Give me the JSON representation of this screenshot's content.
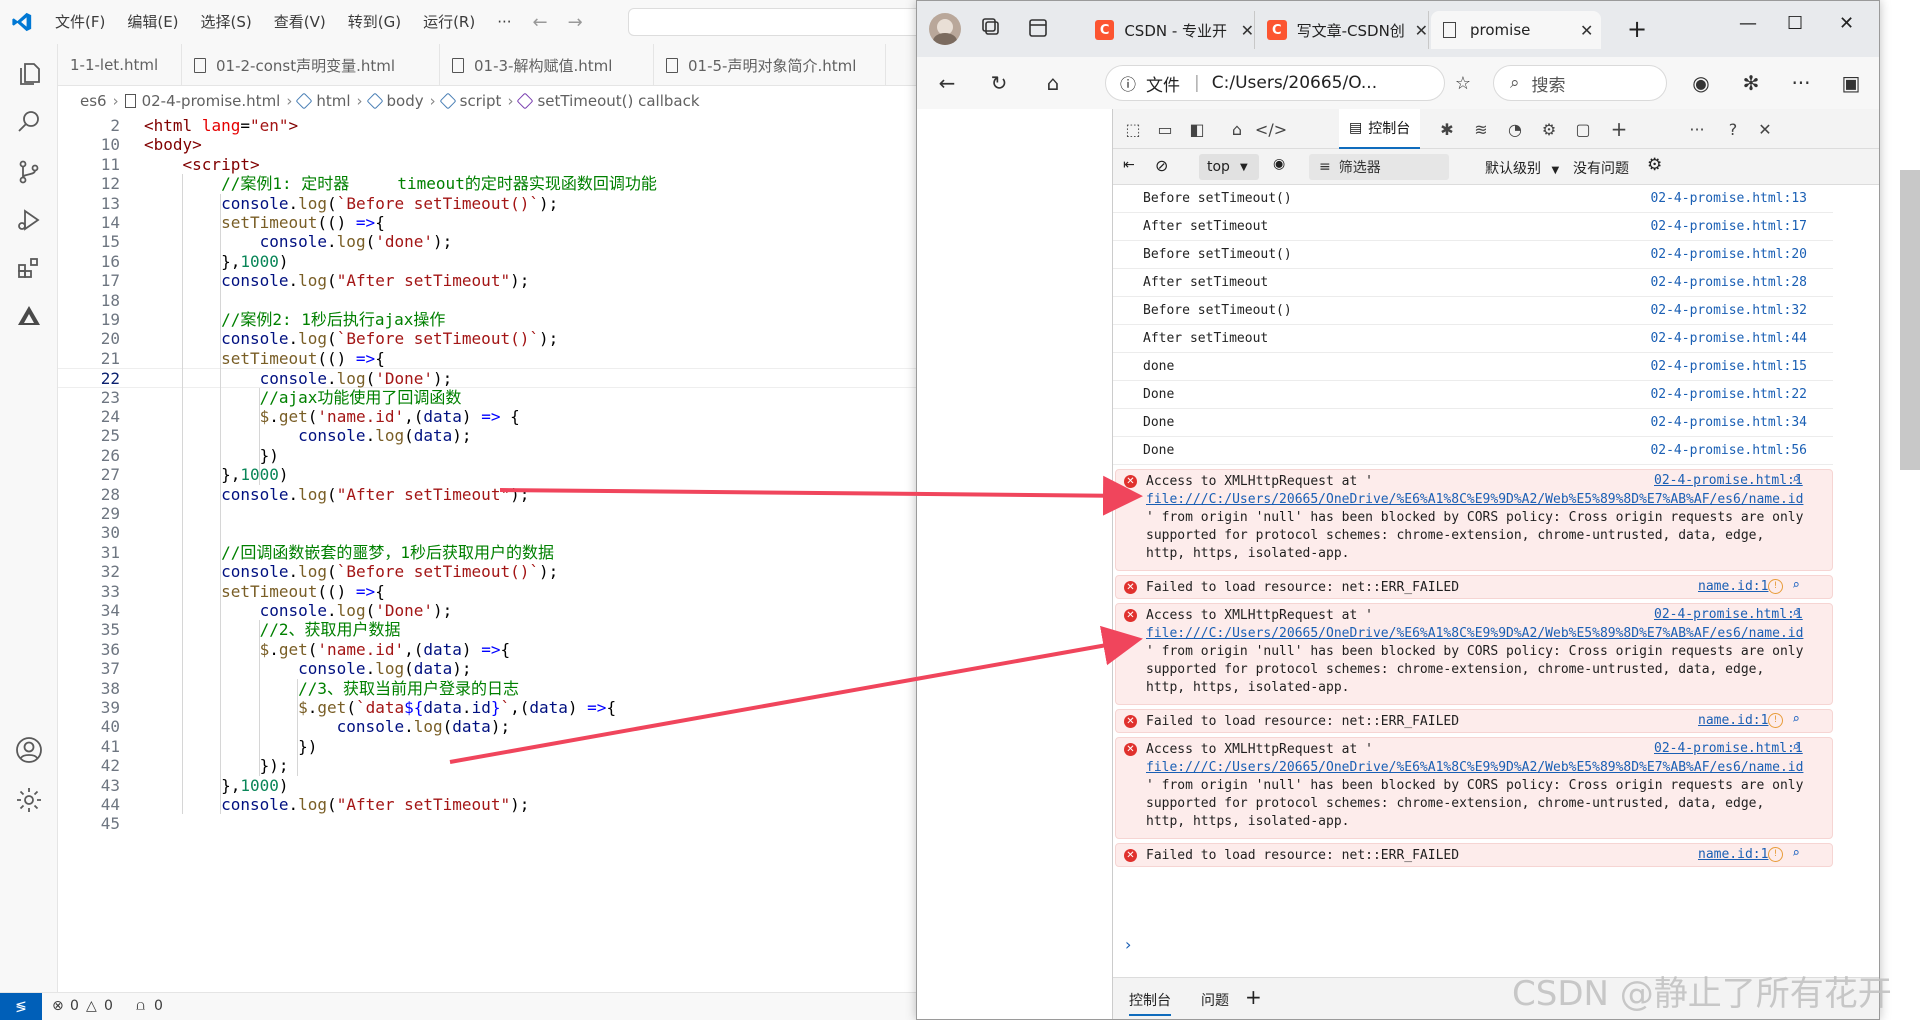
{
  "vscode": {
    "menu": [
      "文件(F)",
      "编辑(E)",
      "选择(S)",
      "查看(V)",
      "转到(G)",
      "运行(R)",
      "···"
    ],
    "tabs": [
      "1-1-let.html",
      "01-2-const声明变量.html",
      "01-3-解构赋值.html",
      "01-5-声明对象简介.html"
    ],
    "breadcrumb": [
      "es6",
      "02-4-promise.html",
      "html",
      "body",
      "script",
      "setTimeout() callback"
    ],
    "code_lines": [
      {
        "n": "2",
        "html": "<span class='tk-tag'>&lt;html</span> <span class='tk-attr'>lang</span>=<span class='tk-str'>\"en\"</span><span class='tk-tag'>&gt;</span>"
      },
      {
        "n": "10",
        "html": "<span class='tk-tag'>&lt;body&gt;</span>"
      },
      {
        "n": "11",
        "html": "    <span class='tk-tag'>&lt;script&gt;</span>"
      },
      {
        "n": "12",
        "html": "        <span class='tk-cmt'>//案例1: 定时器     timeout的定时器实现函数回调功能</span>"
      },
      {
        "n": "13",
        "html": "        <span class='tk-obj'>console</span>.<span class='tk-fn'>log</span>(<span class='tk-str'>`Before setTimeout()`</span>);"
      },
      {
        "n": "14",
        "html": "        <span class='tk-fn'>setTimeout</span>(() <span class='tk-kw'>=&gt;</span>{"
      },
      {
        "n": "15",
        "html": "            <span class='tk-obj'>console</span>.<span class='tk-fn'>log</span>(<span class='tk-str'>'done'</span>);"
      },
      {
        "n": "16",
        "html": "        },<span class='tk-num'>1000</span>)"
      },
      {
        "n": "17",
        "html": "        <span class='tk-obj'>console</span>.<span class='tk-fn'>log</span>(<span class='tk-str'>\"After setTimeout\"</span>);"
      },
      {
        "n": "18",
        "html": ""
      },
      {
        "n": "19",
        "html": "        <span class='tk-cmt'>//案例2: 1秒后执行ajax操作</span>"
      },
      {
        "n": "20",
        "html": "        <span class='tk-obj'>console</span>.<span class='tk-fn'>log</span>(<span class='tk-str'>`Before setTimeout()`</span>);"
      },
      {
        "n": "21",
        "html": "        <span class='tk-fn'>setTimeout</span>(() <span class='tk-kw'>=&gt;</span>{"
      },
      {
        "n": "22",
        "html": "            <span class='tk-obj'>console</span>.<span class='tk-fn'>log</span>(<span class='tk-str'>'Done'</span>);"
      },
      {
        "n": "23",
        "html": "            <span class='tk-cmt'>//ajax功能使用了回调函数</span>"
      },
      {
        "n": "24",
        "html": "            <span class='tk-fn'>$</span>.<span class='tk-fn'>get</span>(<span class='tk-str'>'name.id'</span>,(<span class='tk-obj'>data</span>) <span class='tk-kw'>=&gt;</span> {"
      },
      {
        "n": "25",
        "html": "                <span class='tk-obj'>console</span>.<span class='tk-fn'>log</span>(<span class='tk-obj'>data</span>);"
      },
      {
        "n": "26",
        "html": "            })"
      },
      {
        "n": "27",
        "html": "        },<span class='tk-num'>1000</span>)"
      },
      {
        "n": "28",
        "html": "        <span class='tk-obj'>console</span>.<span class='tk-fn'>log</span>(<span class='tk-str'>\"After setTimeout\"</span>);"
      },
      {
        "n": "29",
        "html": ""
      },
      {
        "n": "30",
        "html": ""
      },
      {
        "n": "31",
        "html": "        <span class='tk-cmt'>//回调函数嵌套的噩梦，1秒后获取用户的数据</span>"
      },
      {
        "n": "32",
        "html": "        <span class='tk-obj'>console</span>.<span class='tk-fn'>log</span>(<span class='tk-str'>`Before setTimeout()`</span>);"
      },
      {
        "n": "33",
        "html": "        <span class='tk-fn'>setTimeout</span>(() <span class='tk-kw'>=&gt;</span>{"
      },
      {
        "n": "34",
        "html": "            <span class='tk-obj'>console</span>.<span class='tk-fn'>log</span>(<span class='tk-str'>'Done'</span>);"
      },
      {
        "n": "35",
        "html": "            <span class='tk-cmt'>//2、获取用户数据</span>"
      },
      {
        "n": "36",
        "html": "            <span class='tk-fn'>$</span>.<span class='tk-fn'>get</span>(<span class='tk-str'>'name.id'</span>,(<span class='tk-obj'>data</span>) <span class='tk-kw'>=&gt;</span>{"
      },
      {
        "n": "37",
        "html": "                <span class='tk-obj'>console</span>.<span class='tk-fn'>log</span>(<span class='tk-obj'>data</span>);"
      },
      {
        "n": "38",
        "html": "                <span class='tk-cmt'>//3、获取当前用户登录的日志</span>"
      },
      {
        "n": "39",
        "html": "                <span class='tk-fn'>$</span>.<span class='tk-fn'>get</span>(<span class='tk-str'>`data</span><span class='tk-kw'>${</span><span class='tk-obj'>data</span>.<span class='tk-obj'>id</span><span class='tk-kw'>}</span><span class='tk-str'>`</span>,(<span class='tk-obj'>data</span>) <span class='tk-kw'>=&gt;</span>{"
      },
      {
        "n": "40",
        "html": "                    <span class='tk-obj'>console</span>.<span class='tk-fn'>log</span>(<span class='tk-obj'>data</span>);"
      },
      {
        "n": "41",
        "html": "                })"
      },
      {
        "n": "42",
        "html": "            });"
      },
      {
        "n": "43",
        "html": "        },<span class='tk-num'>1000</span>)"
      },
      {
        "n": "44",
        "html": "        <span class='tk-obj'>console</span>.<span class='tk-fn'>log</span>(<span class='tk-str'>\"After setTimeout\"</span>);"
      },
      {
        "n": "45",
        "html": ""
      }
    ],
    "active_line": "22",
    "status": {
      "errors": "0",
      "warnings": "0",
      "ports": "0"
    }
  },
  "browser": {
    "tabs": [
      {
        "title": "CSDN - 专业开",
        "icon": "csdn-logo"
      },
      {
        "title": "写文章-CSDN创",
        "icon": "csdn-logo"
      },
      {
        "title": "promise",
        "icon": "page-icon"
      }
    ],
    "address": {
      "scheme_label": "文件",
      "url": "C:/Users/20665/O..."
    },
    "search_label": "搜索",
    "devtools": {
      "active_tab": "控制台",
      "context": "top",
      "filter_label": "筛选器",
      "level_label": "默认级别",
      "issues_label": "没有问题",
      "logs": [
        {
          "msg": "Before setTimeout()",
          "src": "02-4-promise.html:13"
        },
        {
          "msg": "After setTimeout",
          "src": "02-4-promise.html:17"
        },
        {
          "msg": "Before setTimeout()",
          "src": "02-4-promise.html:20"
        },
        {
          "msg": "After setTimeout",
          "src": "02-4-promise.html:28"
        },
        {
          "msg": "Before setTimeout()",
          "src": "02-4-promise.html:32"
        },
        {
          "msg": "After setTimeout",
          "src": "02-4-promise.html:44"
        },
        {
          "msg": "done",
          "src": "02-4-promise.html:15"
        },
        {
          "msg": "Done",
          "src": "02-4-promise.html:22"
        },
        {
          "msg": "Done",
          "src": "02-4-promise.html:34"
        },
        {
          "msg": "Done",
          "src": "02-4-promise.html:56"
        }
      ],
      "errors": [
        {
          "line1": "Access to XMLHttpRequest at '",
          "src": "02-4-promise.html:1",
          "link": "file:///C:/Users/20665/OneDrive/%E6%A1%8C%E9%9D%A2/Web%E5%89%8D%E7%AB%AF/es6/name.id",
          "rest": "' from origin 'null' has been blocked by CORS policy: Cross origin requests are only\nsupported for protocol schemes: chrome-extension, chrome-untrusted, data, edge,\nhttp, https, isolated-app."
        },
        {
          "line1": "Failed to load resource: net::ERR_FAILED",
          "src": "name.id:1"
        },
        {
          "line1": "Access to XMLHttpRequest at '",
          "src": "02-4-promise.html:1",
          "link": "file:///C:/Users/20665/OneDrive/%E6%A1%8C%E9%9D%A2/Web%E5%89%8D%E7%AB%AF/es6/name.id",
          "rest": "' from origin 'null' has been blocked by CORS policy: Cross origin requests are only\nsupported for protocol schemes: chrome-extension, chrome-untrusted, data, edge,\nhttp, https, isolated-app."
        },
        {
          "line1": "Failed to load resource: net::ERR_FAILED",
          "src": "name.id:1"
        },
        {
          "line1": "Access to XMLHttpRequest at '",
          "src": "02-4-promise.html:1",
          "link": "file:///C:/Users/20665/OneDrive/%E6%A1%8C%E9%9D%A2/Web%E5%89%8D%E7%AB%AF/es6/name.id",
          "rest": "' from origin 'null' has been blocked by CORS policy: Cross origin requests are only\nsupported for protocol schemes: chrome-extension, chrome-untrusted, data, edge,\nhttp, https, isolated-app."
        },
        {
          "line1": "Failed to load resource: net::ERR_FAILED",
          "src": "name.id:1"
        }
      ],
      "drawer_tabs": [
        "控制台",
        "问题"
      ]
    }
  },
  "watermark": "CSDN @静止了所有花开",
  "colors": {
    "arrow": "#f0455c",
    "accent": "#005fb8",
    "error_bg": "#fdeceb"
  }
}
